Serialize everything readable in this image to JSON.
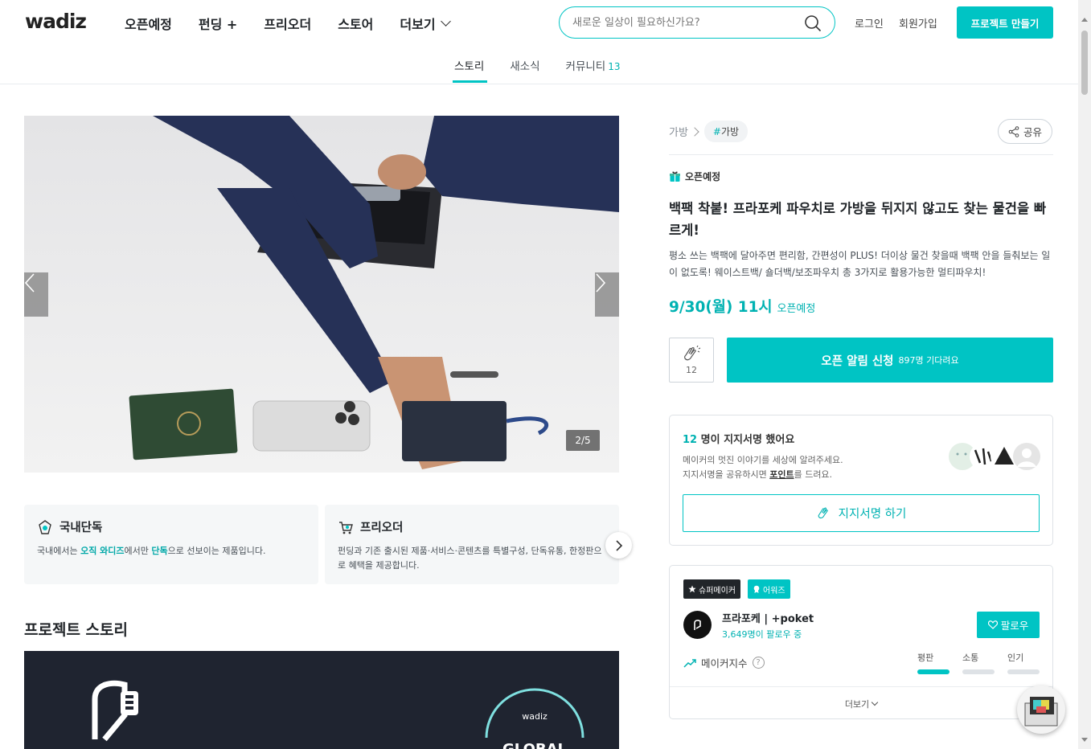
{
  "header": {
    "logo": "wadiz",
    "nav": [
      {
        "label": "오픈예정"
      },
      {
        "label": "펀딩 +"
      },
      {
        "label": "프리오더"
      },
      {
        "label": "스토어"
      },
      {
        "label": "더보기"
      }
    ],
    "search_placeholder": "새로운 일상이 필요하신가요?",
    "login": "로그인",
    "signup": "회원가입",
    "make_project": "프로젝트 만들기",
    "tabs": [
      {
        "label": "스토리",
        "count": ""
      },
      {
        "label": "새소식",
        "count": ""
      },
      {
        "label": "커뮤니티",
        "count": "13"
      }
    ]
  },
  "gallery": {
    "counter": "2/5"
  },
  "features": [
    {
      "title": "국내단독",
      "desc_parts": [
        "국내에서는 ",
        "오직 와디즈",
        "에서만 ",
        "단독",
        "으로 선보이는 제품입니다."
      ]
    },
    {
      "title": "프리오더",
      "desc": "펀딩과 기존 출시된 제품·서비스·콘텐츠를 특별구성, 단독유통, 한정판으로 혜택을 제공합니다."
    }
  ],
  "story": {
    "title": "프로젝트 스토리",
    "banner_badge": "wadiz",
    "banner_text": "GLOBAL"
  },
  "project": {
    "category": "가방",
    "tag": "가방",
    "share": "공유",
    "status": "오픈예정",
    "title": "백팩 착붙! 프라포케 파우치로 가방을 뒤지지 않고도 찾는 물건을 빠르게!",
    "description": "평소 쓰는 백팩에 달아주면 편리함, 간편성이 PLUS! 더이상 물건 찾을때 백팩 안을 들춰보는 일이 없도록! 웨이스트백/ 숄더백/보조파우치 총 3가지로 활용가능한 멀티파우치!",
    "open_date": "9/30(월) 11시",
    "open_label": "오픈예정",
    "likes": "12",
    "notify_label": "오픈 알림 신청",
    "notify_count": "897명 기다려요"
  },
  "signature": {
    "count": "12",
    "heading": " 명이 지지서명 했어요",
    "line1": "메이커의 멋진 이야기를 세상에 알려주세요.",
    "line2_pre": "지지서명을 공유하시면 ",
    "line2_point": "포인트",
    "line2_post": "를 드려요.",
    "button": "지지서명 하기"
  },
  "maker": {
    "badges": [
      "슈퍼메이커",
      "어워즈"
    ],
    "name": "프라포케 | +poket",
    "followers": "3,649명이 팔로우 중",
    "follow": "팔로우",
    "index_label": "메이커지수",
    "metrics": [
      {
        "label": "평판",
        "active": true
      },
      {
        "label": "소통",
        "active": false
      },
      {
        "label": "인기",
        "active": false
      }
    ],
    "more": "더보기"
  },
  "colors": {
    "accent": "#00c4c4",
    "accent_text": "#00b2b2"
  }
}
